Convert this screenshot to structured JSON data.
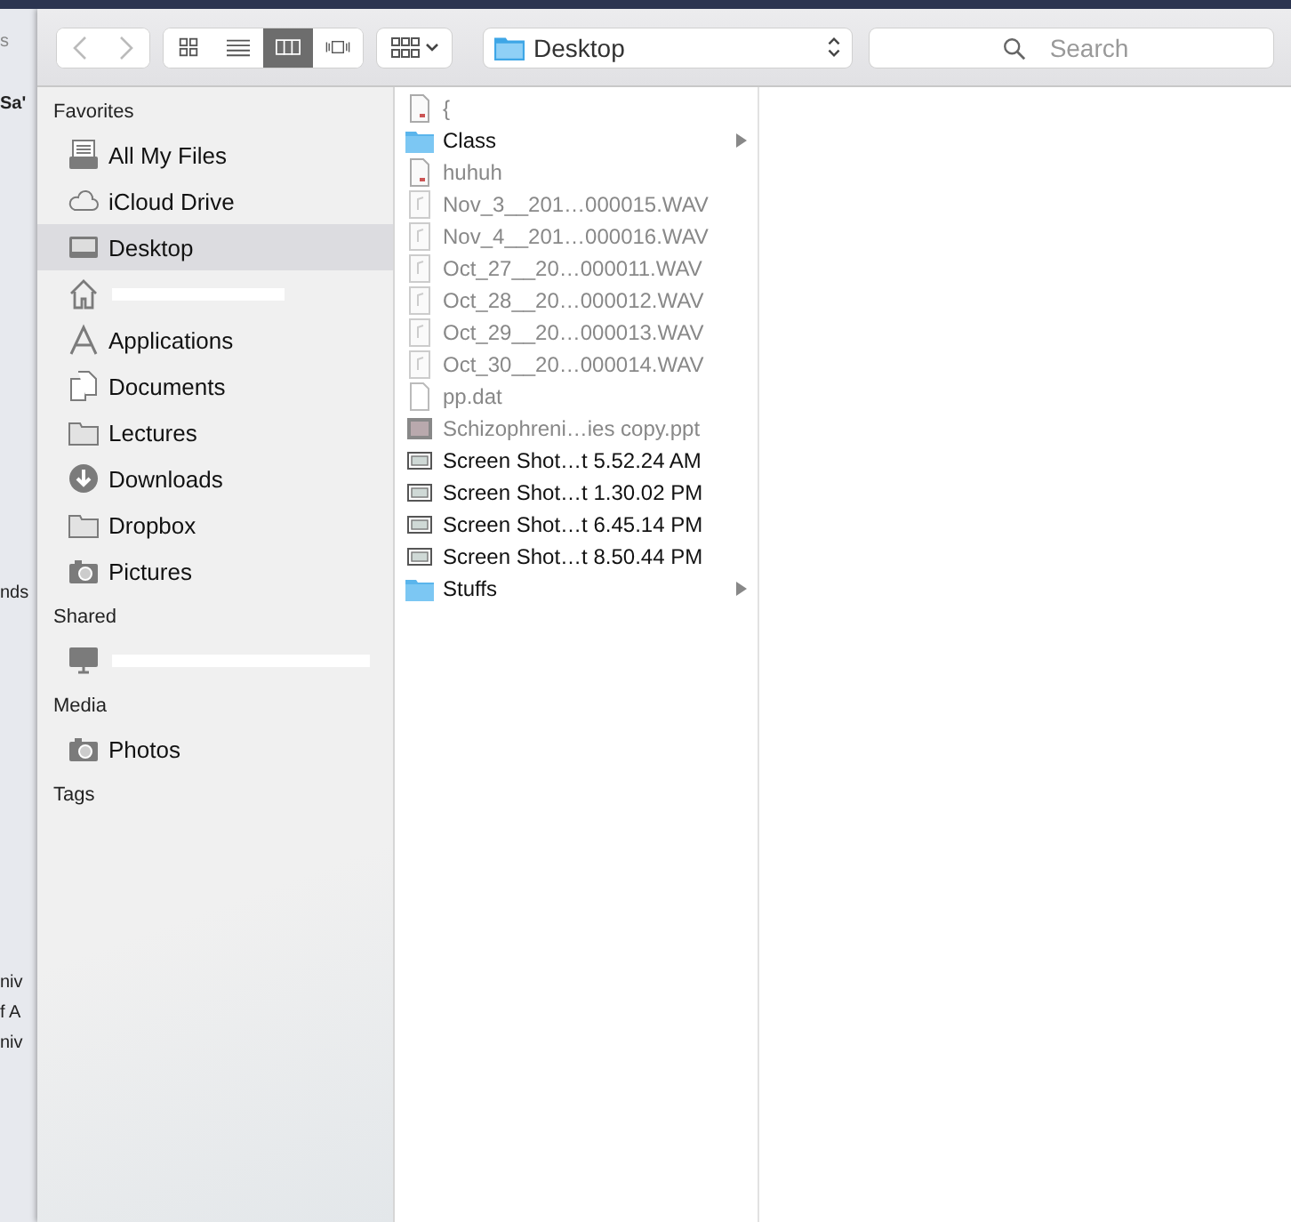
{
  "background_window": {
    "top_texts": [
      "s",
      "Sa'"
    ],
    "lower_texts": [
      "nds",
      "niv",
      "f A",
      "niv"
    ]
  },
  "toolbar": {
    "view_modes": [
      {
        "kind": "icons",
        "selected": false
      },
      {
        "kind": "list",
        "selected": false
      },
      {
        "kind": "columns",
        "selected": true
      },
      {
        "kind": "coverflow",
        "selected": false
      }
    ],
    "path": "Desktop",
    "search": {
      "placeholder": "Search"
    }
  },
  "sidebar": {
    "sections": [
      {
        "title": "Favorites",
        "items": [
          {
            "kind": "files",
            "label": "All My Files",
            "selected": false
          },
          {
            "kind": "cloud",
            "label": "iCloud Drive",
            "selected": false
          },
          {
            "kind": "desktop",
            "label": "Desktop",
            "selected": true
          },
          {
            "kind": "home",
            "redacted": true,
            "selected": false
          },
          {
            "kind": "apps",
            "label": "Applications",
            "selected": false
          },
          {
            "kind": "docs",
            "label": "Documents",
            "selected": false
          },
          {
            "kind": "folder",
            "label": "Lectures",
            "selected": false
          },
          {
            "kind": "download",
            "label": "Downloads",
            "selected": false
          },
          {
            "kind": "folder",
            "label": "Dropbox",
            "selected": false
          },
          {
            "kind": "camera",
            "label": "Pictures",
            "selected": false
          }
        ]
      },
      {
        "title": "Shared",
        "items": [
          {
            "kind": "computer",
            "redacted": true,
            "selected": false
          }
        ]
      },
      {
        "title": "Media",
        "items": [
          {
            "kind": "camera",
            "label": "Photos",
            "selected": false
          }
        ]
      },
      {
        "title": "Tags"
      }
    ]
  },
  "column": {
    "files": [
      {
        "kind": "doc",
        "name": "{",
        "dimmed": true
      },
      {
        "kind": "folder",
        "name": "Class",
        "dimmed": false
      },
      {
        "kind": "doc",
        "name": "huhuh",
        "dimmed": true
      },
      {
        "kind": "audio",
        "name": "Nov_3__201…000015.WAV",
        "dimmed": true
      },
      {
        "kind": "audio",
        "name": "Nov_4__201…000016.WAV",
        "dimmed": true
      },
      {
        "kind": "audio",
        "name": "Oct_27__20…000011.WAV",
        "dimmed": true
      },
      {
        "kind": "audio",
        "name": "Oct_28__20…000012.WAV",
        "dimmed": true
      },
      {
        "kind": "audio",
        "name": "Oct_29__20…000013.WAV",
        "dimmed": true
      },
      {
        "kind": "audio",
        "name": "Oct_30__20…000014.WAV",
        "dimmed": true
      },
      {
        "kind": "blank",
        "name": "pp.dat",
        "dimmed": true
      },
      {
        "kind": "slides",
        "name": "Schizophreni…ies copy.ppt",
        "dimmed": true
      },
      {
        "kind": "screenshot",
        "name": "Screen Shot…t 5.52.24 AM",
        "dimmed": false
      },
      {
        "kind": "screenshot",
        "name": "Screen Shot…t 1.30.02 PM",
        "dimmed": false
      },
      {
        "kind": "screenshot",
        "name": "Screen Shot…t 6.45.14 PM",
        "dimmed": false
      },
      {
        "kind": "screenshot",
        "name": "Screen Shot…t 8.50.44 PM",
        "dimmed": false
      },
      {
        "kind": "folder",
        "name": "Stuffs",
        "dimmed": false
      }
    ]
  }
}
